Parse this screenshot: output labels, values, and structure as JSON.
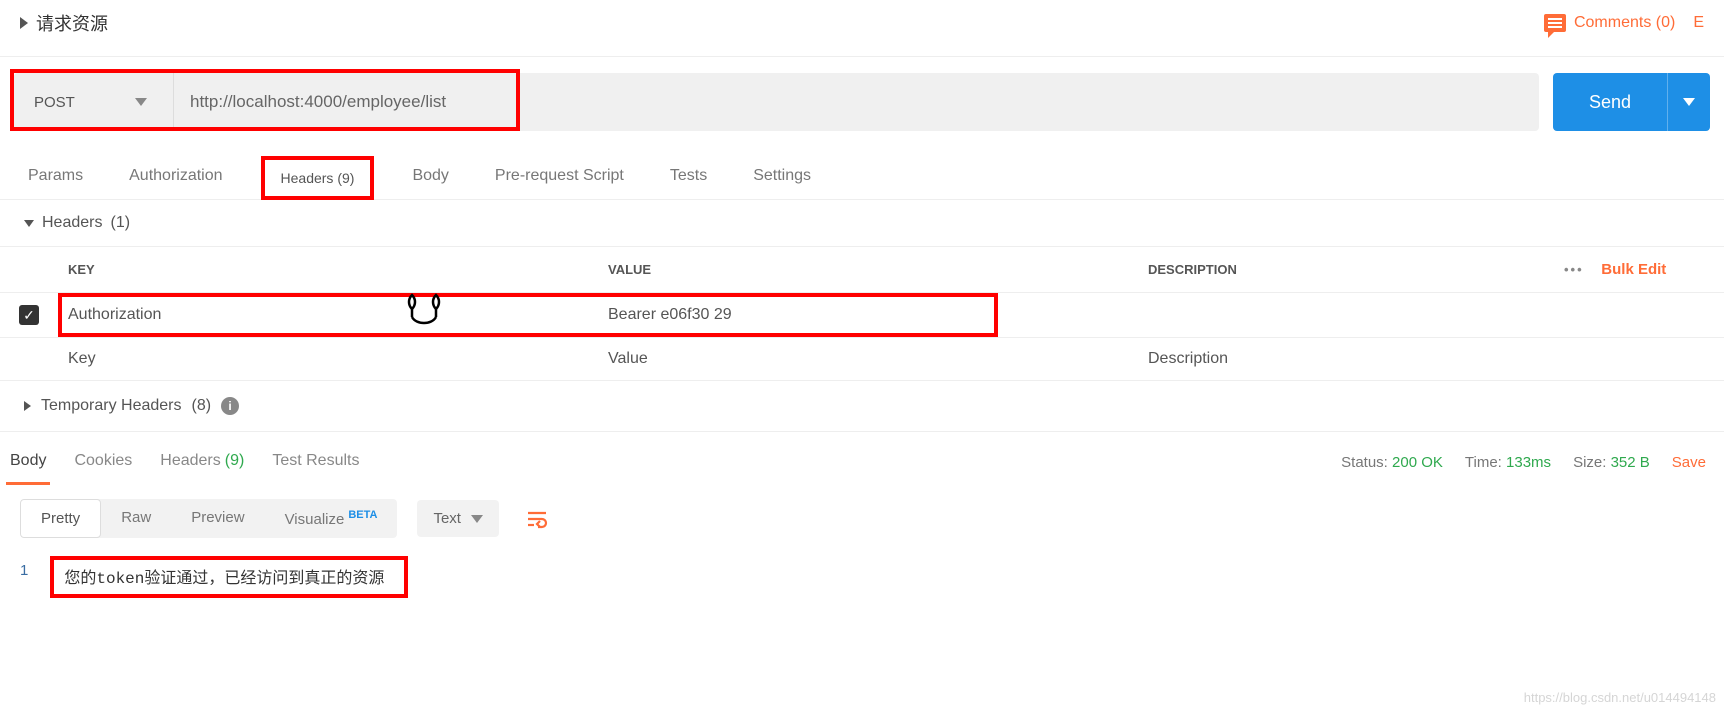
{
  "header": {
    "title": "请求资源",
    "comments_label": "Comments (0)",
    "examples_label": "E"
  },
  "request": {
    "method": "POST",
    "url": "http://localhost:4000/employee/list",
    "send_label": "Send"
  },
  "request_tabs": {
    "params": "Params",
    "authorization": "Authorization",
    "headers_label": "Headers",
    "headers_count": "(9)",
    "body": "Body",
    "prerequest": "Pre-request Script",
    "tests": "Tests",
    "settings": "Settings"
  },
  "headers_section": {
    "toggle_label": "Headers",
    "toggle_count": "(1)",
    "table_headers": {
      "key": "KEY",
      "value": "VALUE",
      "description": "DESCRIPTION",
      "bulk_edit": "Bulk Edit"
    },
    "rows": {
      "row0_key": "Authorization",
      "row0_value": "Bearer e06f30                                       29"
    },
    "placeholders": {
      "key": "Key",
      "value": "Value",
      "description": "Description"
    },
    "temporary_label": "Temporary Headers",
    "temporary_count": "(8)"
  },
  "response_tabs": {
    "body": "Body",
    "cookies": "Cookies",
    "headers_label": "Headers",
    "headers_count": "(9)",
    "test_results": "Test Results"
  },
  "response_meta": {
    "status_label": "Status:",
    "status_value": "200 OK",
    "time_label": "Time:",
    "time_value": "133ms",
    "size_label": "Size:",
    "size_value": "352 B",
    "save_label": "Save"
  },
  "response_toolbar": {
    "pretty": "Pretty",
    "raw": "Raw",
    "preview": "Preview",
    "visualize": "Visualize",
    "beta": "BETA",
    "format": "Text"
  },
  "response_body": {
    "line_no": "1",
    "text_pre": "您的",
    "text_token": "token",
    "text_post": "验证通过，已经访问到真正的资源"
  },
  "watermark": "https://blog.csdn.net/u014494148"
}
